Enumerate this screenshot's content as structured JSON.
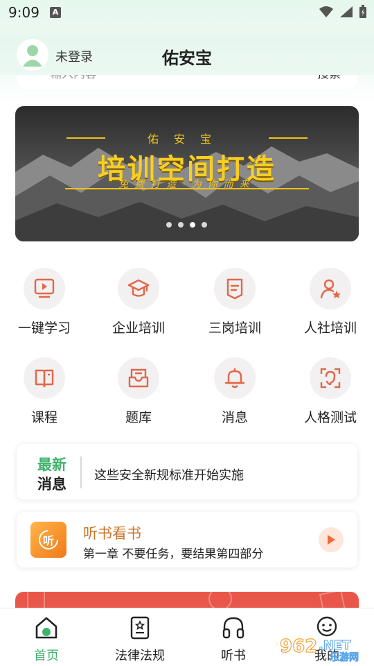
{
  "status_bar": {
    "time": "9:09",
    "notification_letter": "A"
  },
  "header": {
    "login_status": "未登录",
    "title": "佑安宝"
  },
  "search": {
    "placeholder": "输入内容",
    "button_label": "搜索"
  },
  "banner": {
    "top_text": "佑安宝",
    "main_text": "培训空间打造",
    "sub_text": "免费打造·为你而来",
    "page_count": 4,
    "active_index": 2
  },
  "grid": {
    "items": [
      {
        "label": "一键学习",
        "icon": "play-screen-icon"
      },
      {
        "label": "企业培训",
        "icon": "graduation-cap-icon"
      },
      {
        "label": "三岗培训",
        "icon": "document-icon"
      },
      {
        "label": "人社培训",
        "icon": "user-star-icon"
      },
      {
        "label": "课程",
        "icon": "book-icon"
      },
      {
        "label": "题库",
        "icon": "inbox-icon"
      },
      {
        "label": "消息",
        "icon": "bell-icon"
      },
      {
        "label": "人格测试",
        "icon": "face-scan-icon"
      }
    ]
  },
  "news": {
    "badge_line1": "最新",
    "badge_line2": "消息",
    "headline": "这些安全新规标准开始实施"
  },
  "audio": {
    "icon_char": "听",
    "title": "听书看书",
    "subtitle": "第一章 不要任务，要结果第四部分"
  },
  "tabbar": {
    "items": [
      {
        "label": "首页",
        "icon": "home-icon",
        "active": true
      },
      {
        "label": "法律法规",
        "icon": "law-document-icon",
        "active": false
      },
      {
        "label": "听书",
        "icon": "headphones-icon",
        "active": false
      },
      {
        "label": "我的",
        "icon": "profile-icon",
        "active": false
      }
    ]
  },
  "watermark": {
    "text_1": "962",
    "text_2": ".NET",
    "text_3": "乐游网"
  },
  "colors": {
    "accent_green": "#3fb26c",
    "icon_orange": "#e2664a",
    "banner_gold": "#f7cf24",
    "audio_title": "#c9742a"
  }
}
